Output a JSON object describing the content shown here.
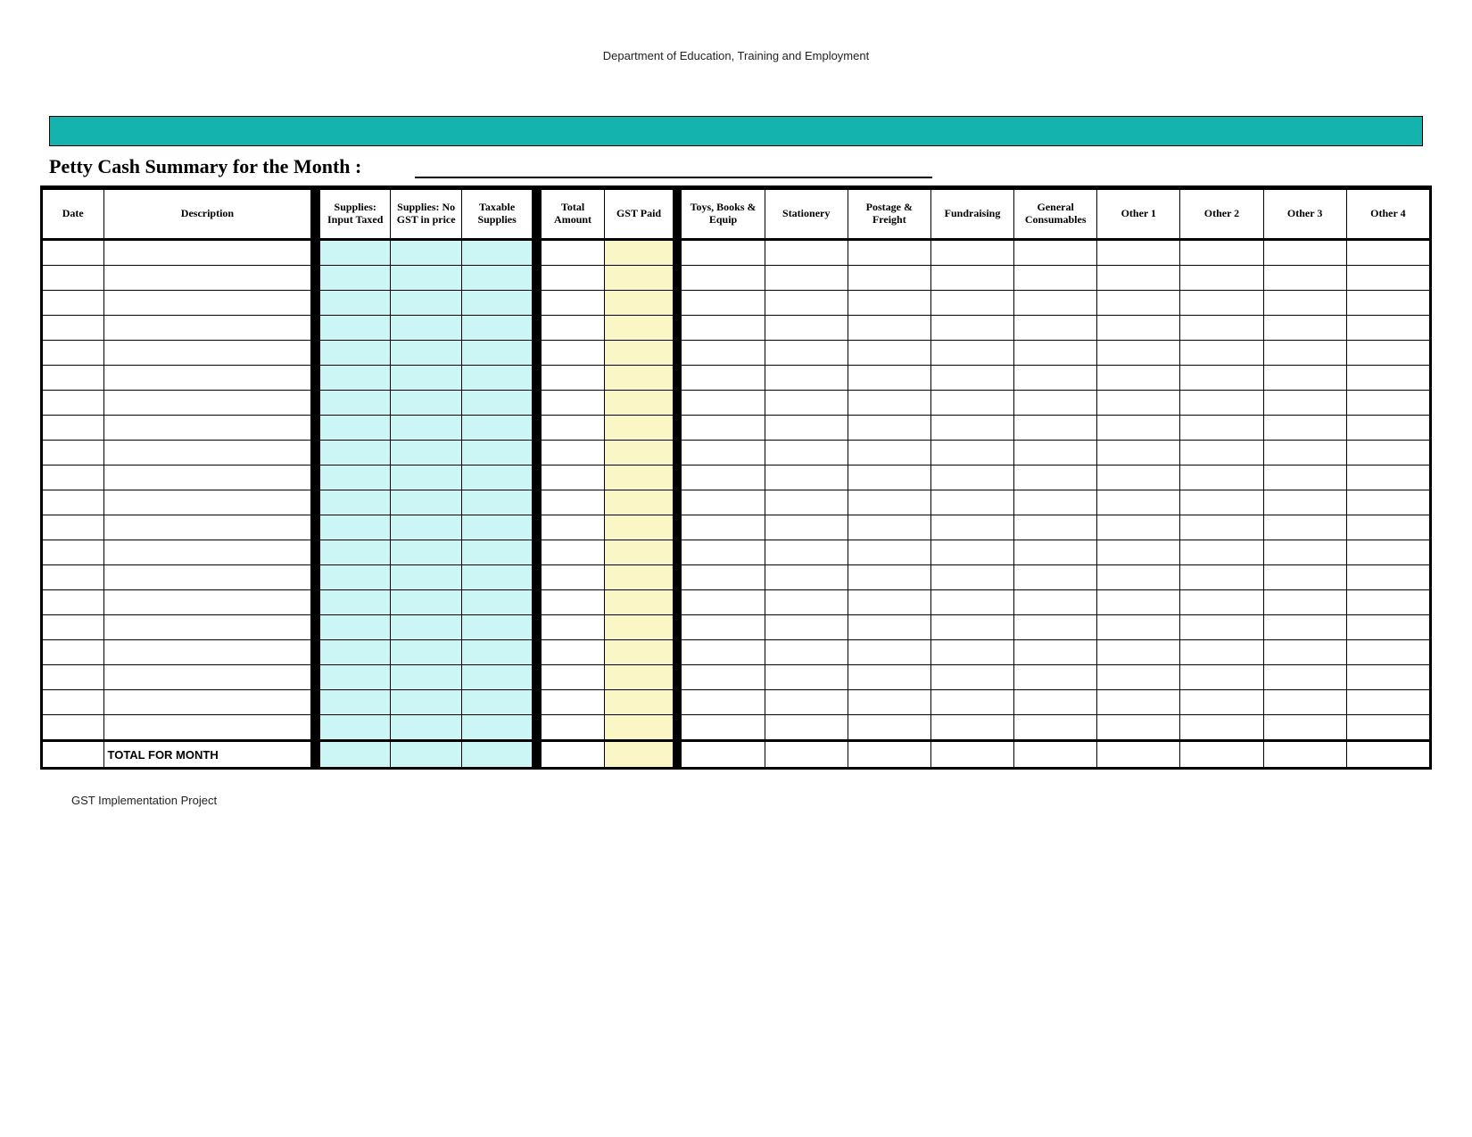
{
  "org_header": "Department of Education, Training and Employment",
  "title": "Petty Cash Summary for the Month :",
  "footer_note": "GST Implementation Project",
  "columns": {
    "date": "Date",
    "description": "Description",
    "supplies_input_taxed": "Supplies: Input Taxed",
    "supplies_no_gst": "Supplies: No GST in price",
    "taxable_supplies": "Taxable Supplies",
    "total_amount": "Total Amount",
    "gst_paid": "GST Paid",
    "toys_books_equip": "Toys, Books & Equip",
    "stationery": "Stationery",
    "postage_freight": "Postage & Freight",
    "fundraising": "Fundraising",
    "general_consumables": "General Consumables",
    "other1": "Other 1",
    "other2": "Other 2",
    "other3": "Other 3",
    "other4": "Other 4"
  },
  "total_row_label": "TOTAL FOR MONTH",
  "blank_row_count": 20,
  "colors": {
    "teal_bar": "#14b3ad",
    "light_blue": "#ccf5f5",
    "light_yellow": "#fbf6c5"
  }
}
